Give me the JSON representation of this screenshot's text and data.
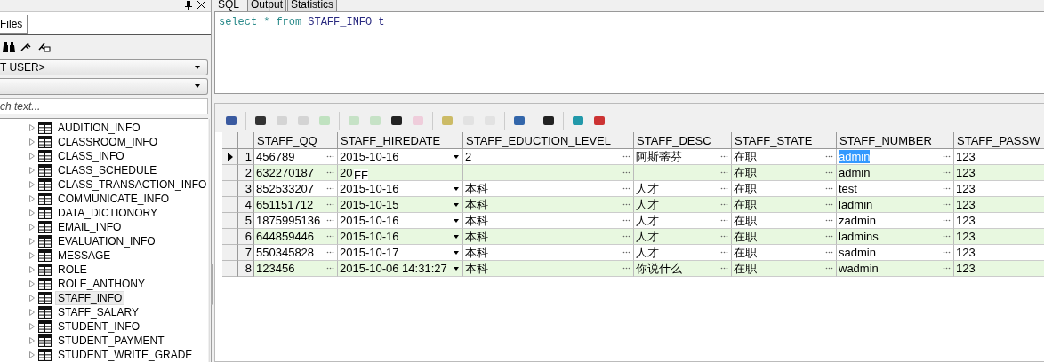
{
  "left_panel": {
    "tab": "Files",
    "user_dropdown": "T USER>",
    "search": {
      "placeholder": "ch text..."
    },
    "tree_items": [
      {
        "label": "AUDITION_INFO",
        "selected": false
      },
      {
        "label": "CLASSROOM_INFO",
        "selected": false
      },
      {
        "label": "CLASS_INFO",
        "selected": false
      },
      {
        "label": "CLASS_SCHEDULE",
        "selected": false
      },
      {
        "label": "CLASS_TRANSACTION_INFO",
        "selected": false
      },
      {
        "label": "COMMUNICATE_INFO",
        "selected": false
      },
      {
        "label": "DATA_DICTIONORY",
        "selected": false
      },
      {
        "label": "EMAIL_INFO",
        "selected": false
      },
      {
        "label": "EVALUATION_INFO",
        "selected": false
      },
      {
        "label": "MESSAGE",
        "selected": false
      },
      {
        "label": "ROLE",
        "selected": false
      },
      {
        "label": "ROLE_ANTHONY",
        "selected": false
      },
      {
        "label": "STAFF_INFO",
        "selected": true
      },
      {
        "label": "STAFF_SALARY",
        "selected": false
      },
      {
        "label": "STUDENT_INFO",
        "selected": false
      },
      {
        "label": "STUDENT_PAYMENT",
        "selected": false
      },
      {
        "label": "STUDENT_WRITE_GRADE",
        "selected": false
      }
    ]
  },
  "tabs": [
    {
      "label": "SQL",
      "selected": true
    },
    {
      "label": "Output",
      "selected": false
    },
    {
      "label": "Statistics",
      "selected": false
    }
  ],
  "sql": [
    {
      "kind": "keyword",
      "text": "select"
    },
    {
      "kind": "keyword",
      "text": "*"
    },
    {
      "kind": "keyword",
      "text": "from"
    },
    {
      "kind": "ident",
      "text": "STAFF_INFO"
    },
    {
      "kind": "ident",
      "text": "t"
    }
  ],
  "grid": {
    "columns": [
      "STAFF_QQ",
      "STAFF_HIREDATE",
      "STAFF_EDUCTION_LEVEL",
      "STAFF_DESC",
      "STAFF_STATE",
      "STAFF_NUMBER",
      "STAFF_PASSW"
    ],
    "rows": [
      {
        "number": "1",
        "current": true,
        "cells": [
          {
            "text": "456789",
            "selected": false
          },
          {
            "text": "2015-10-16",
            "selected": false
          },
          {
            "text": "2",
            "selected": false
          },
          {
            "text": "阿斯蒂芬",
            "selected": false
          },
          {
            "text": "在职",
            "selected": false
          },
          {
            "text": "admin",
            "selected": true
          },
          {
            "text": "123",
            "selected": false
          }
        ]
      },
      {
        "number": "2",
        "current": false,
        "editor_text": "FF",
        "cells": [
          {
            "text": "632270187",
            "selected": false
          },
          {
            "text": "20",
            "selected": false
          },
          {
            "selected": false
          },
          {
            "selected": false
          },
          {
            "text": "在职",
            "selected": false
          },
          {
            "text": "admin",
            "selected": false
          },
          {
            "text": "123",
            "selected": false
          }
        ]
      },
      {
        "number": "3",
        "current": false,
        "cells": [
          {
            "text": "852533207",
            "selected": false
          },
          {
            "text": "2015-10-16",
            "selected": false
          },
          {
            "text": "本科",
            "selected": false
          },
          {
            "text": "人才",
            "selected": false
          },
          {
            "text": "在职",
            "selected": false
          },
          {
            "text": "test",
            "selected": false
          },
          {
            "text": "123",
            "selected": false
          }
        ]
      },
      {
        "number": "4",
        "current": false,
        "cells": [
          {
            "text": "651151712",
            "selected": false
          },
          {
            "text": "2015-10-15",
            "selected": false
          },
          {
            "text": "本科",
            "selected": false
          },
          {
            "text": "人才",
            "selected": false
          },
          {
            "text": "在职",
            "selected": false
          },
          {
            "text": "ladmin",
            "selected": false
          },
          {
            "text": "123",
            "selected": false
          }
        ]
      },
      {
        "number": "5",
        "current": false,
        "cells": [
          {
            "text": "1875995136",
            "selected": false
          },
          {
            "text": "2015-10-16",
            "selected": false
          },
          {
            "text": "本科",
            "selected": false
          },
          {
            "text": "人才",
            "selected": false
          },
          {
            "text": "在职",
            "selected": false
          },
          {
            "text": "zadmin",
            "selected": false
          },
          {
            "text": "123",
            "selected": false
          }
        ]
      },
      {
        "number": "6",
        "current": false,
        "cells": [
          {
            "text": "644859446",
            "selected": false
          },
          {
            "text": "2015-10-16",
            "selected": false
          },
          {
            "text": "本科",
            "selected": false
          },
          {
            "text": "人才",
            "selected": false
          },
          {
            "text": "在职",
            "selected": false
          },
          {
            "text": "ladmins",
            "selected": false
          },
          {
            "text": "123",
            "selected": false
          }
        ]
      },
      {
        "number": "7",
        "current": false,
        "cells": [
          {
            "text": "550345828",
            "selected": false
          },
          {
            "text": "2015-10-17",
            "selected": false
          },
          {
            "text": "本科",
            "selected": false
          },
          {
            "text": "人才",
            "selected": false
          },
          {
            "text": "在职",
            "selected": false
          },
          {
            "text": "sadmin",
            "selected": false
          },
          {
            "text": "123",
            "selected": false
          }
        ]
      },
      {
        "number": "8",
        "current": false,
        "cells": [
          {
            "text": "123456",
            "selected": false
          },
          {
            "text": "2015-10-06 14:31:27",
            "selected": false
          },
          {
            "text": "本科",
            "selected": false
          },
          {
            "text": "你说什么",
            "selected": false
          },
          {
            "text": "在职",
            "selected": false
          },
          {
            "text": "wadmin",
            "selected": false
          },
          {
            "text": "123",
            "selected": false
          }
        ]
      }
    ]
  }
}
